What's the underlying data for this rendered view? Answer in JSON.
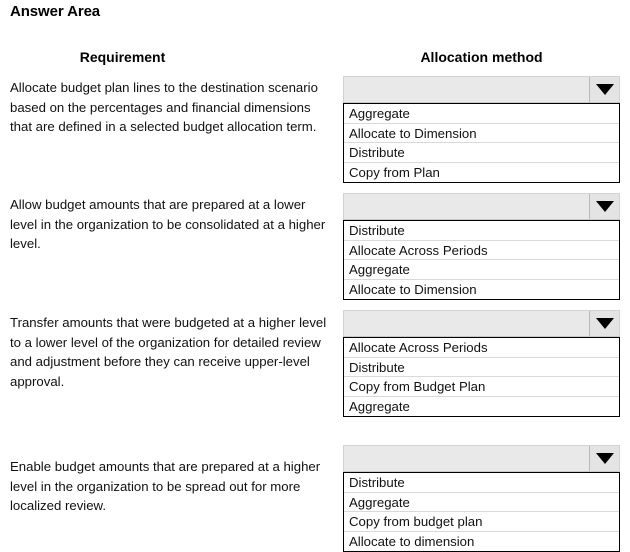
{
  "page_title": "Answer Area",
  "columns": {
    "requirement": "Requirement",
    "allocation_method": "Allocation method"
  },
  "icons": {
    "dropdown_arrow": "chevron-down-icon"
  },
  "rows": [
    {
      "requirement": "Allocate budget plan lines to the destination scenario based on the percentages and financial dimensions that are defined in a selected budget allocation term.",
      "dropdown": {
        "selected": "",
        "options": [
          "Aggregate",
          "Allocate to Dimension",
          "Distribute",
          "Copy from Plan"
        ]
      }
    },
    {
      "requirement": "Allow budget amounts that are prepared at a lower level in the organization to be consolidated at a higher level.",
      "dropdown": {
        "selected": "",
        "options": [
          "Distribute",
          "Allocate Across Periods",
          "Aggregate",
          "Allocate to Dimension"
        ]
      }
    },
    {
      "requirement": "Transfer amounts that were budgeted at a higher level to a lower level of the organization for detailed review and adjustment before they can receive upper-level approval.",
      "dropdown": {
        "selected": "",
        "options": [
          "Allocate Across Periods",
          "Distribute",
          "Copy from Budget Plan",
          "Aggregate"
        ]
      }
    },
    {
      "requirement": "Enable budget amounts that are prepared at a higher level in the organization to be spread out for more localized review.",
      "dropdown": {
        "selected": "",
        "options": [
          "Distribute",
          "Aggregate",
          "Copy from budget plan",
          "Allocate to dimension"
        ]
      }
    }
  ],
  "layout": {
    "row_tops": [
      76,
      193,
      310,
      445
    ],
    "req_tops": [
      78,
      195,
      313,
      457
    ]
  }
}
